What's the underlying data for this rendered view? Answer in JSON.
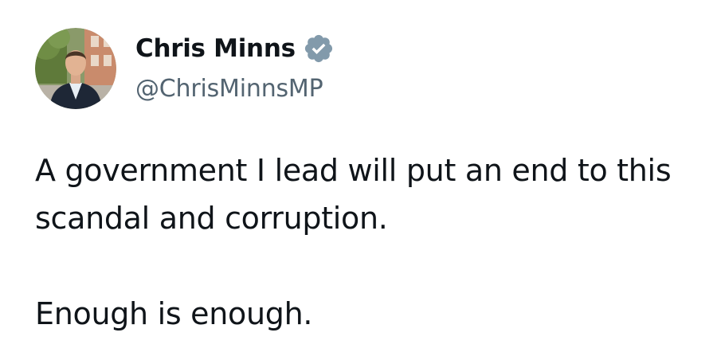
{
  "author": {
    "display_name": "Chris Minns",
    "handle": "@ChrisMinnsMP",
    "avatar_icon": "profile-photo",
    "verified_icon": "verified-badge-icon",
    "verified_color": "#829aab"
  },
  "tweet": {
    "paragraphs": [
      "A government I lead will put an end to this scandal and corruption.",
      "Enough is enough."
    ]
  }
}
